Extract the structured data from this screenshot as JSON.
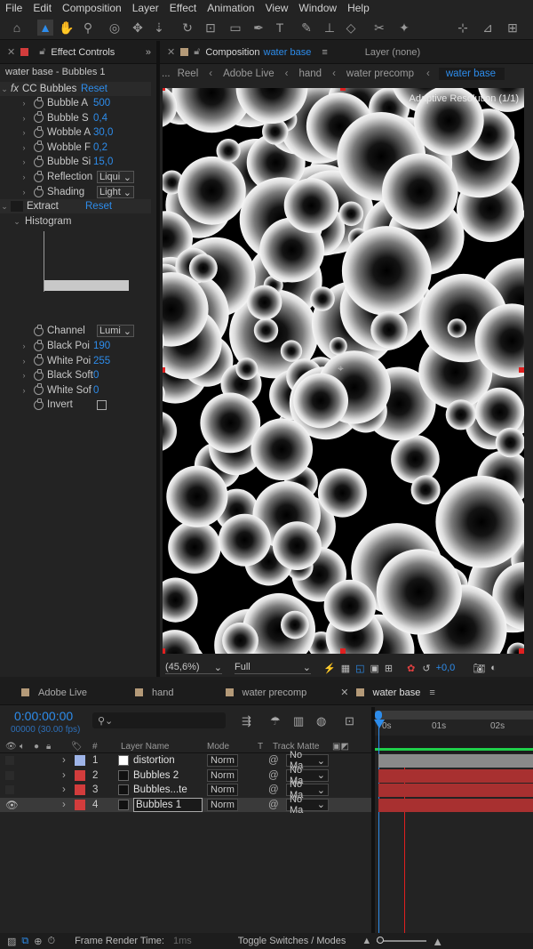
{
  "menu": [
    "File",
    "Edit",
    "Composition",
    "Layer",
    "Effect",
    "Animation",
    "View",
    "Window",
    "Help"
  ],
  "effect_controls": {
    "tab_label": "Effect Controls",
    "subtitle": "water base - Bubbles 1",
    "effects": [
      {
        "name": "CC Bubbles",
        "reset": "Reset"
      },
      {
        "name": "Extract",
        "reset": "Reset"
      }
    ],
    "cc_bubbles_props": [
      {
        "label": "Bubble A",
        "value": "500"
      },
      {
        "label": "Bubble S",
        "value": "0,4"
      },
      {
        "label": "Wobble A",
        "value": "30,0"
      },
      {
        "label": "Wobble F",
        "value": "0,2"
      },
      {
        "label": "Bubble Si",
        "value": "15,0"
      }
    ],
    "reflection": {
      "label": "Reflection",
      "value": "Liqui"
    },
    "shading": {
      "label": "Shading",
      "value": "Light"
    },
    "histogram_label": "Histogram",
    "channel": {
      "label": "Channel",
      "value": "Lumi"
    },
    "extract_props": [
      {
        "label": "Black Poi",
        "value": "190"
      },
      {
        "label": "White Poi",
        "value": "255"
      },
      {
        "label": "Black Soft",
        "value": "0"
      },
      {
        "label": "White Sof",
        "value": "0"
      }
    ],
    "invert_label": "Invert"
  },
  "composition": {
    "tab_prefix": "Composition",
    "tab_name": "water base",
    "layer_tab": "Layer  (none)",
    "breadcrumbs": [
      "...",
      "Reel",
      "Adobe Live",
      "hand",
      "water precomp",
      "water base"
    ],
    "adaptive_text": "Adaptive Resolution (1/1)",
    "zoom": "(45,6%)",
    "resolution": "Full",
    "exposure": "+0,0"
  },
  "timeline": {
    "tabs": [
      "Adobe Live",
      "hand",
      "water precomp",
      "water base"
    ],
    "timecode": "0:00:00:00",
    "fps": "00000 (30.00 fps)",
    "search_placeholder": "",
    "ruler": [
      "0s",
      "01s",
      "02s"
    ],
    "headers": {
      "num": "#",
      "layer_name": "Layer Name",
      "mode": "Mode",
      "t": "T",
      "track_matte": "Track Matte"
    },
    "layers": [
      {
        "num": "1",
        "name": "distortion",
        "mode": "Norm",
        "matte": "No Ma",
        "label_color": "#9eb4e8",
        "solid": "#ffffff"
      },
      {
        "num": "2",
        "name": "Bubbles 2",
        "mode": "Norm",
        "matte": "No Ma",
        "label_color": "#d23c3c",
        "solid": "#111111"
      },
      {
        "num": "3",
        "name": "Bubbles...te",
        "mode": "Norm",
        "matte": "No Ma",
        "label_color": "#d23c3c",
        "solid": "#111111"
      },
      {
        "num": "4",
        "name": "Bubbles 1",
        "mode": "Norm",
        "matte": "No Ma",
        "label_color": "#d23c3c",
        "solid": "#111111"
      }
    ],
    "footer": {
      "render_label": "Frame Render Time:",
      "render_value": "1ms",
      "toggle": "Toggle Switches / Modes"
    }
  },
  "colors": {
    "accent": "#2d8ceb",
    "layer_red": "#d23c3c",
    "layer_blue": "#9eb4e8"
  }
}
